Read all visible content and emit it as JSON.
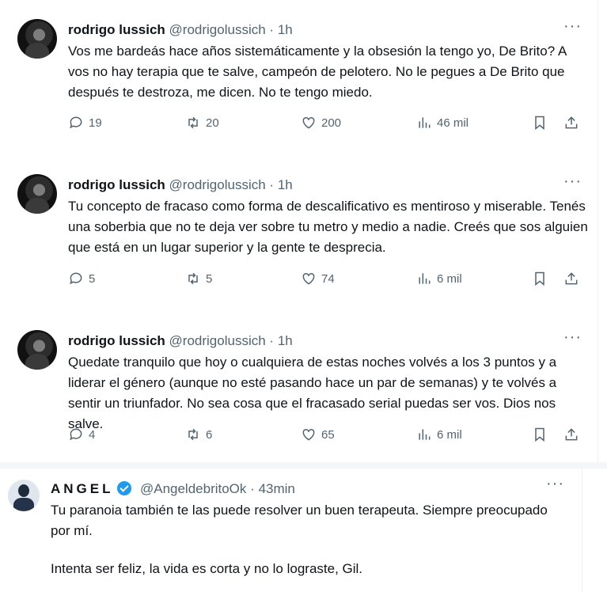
{
  "tweets": [
    {
      "name": "rodrigo lussich",
      "handle": "@rodrigolussich",
      "dot": "·",
      "time": "1h",
      "more": "···",
      "text": "Vos me bardeás hace años sistemáticamente y la obsesión la tengo yo, De Brito? A vos no hay terapia que te salve, campeón de pelotero. No le pegues a De Brito que después te destroza, me dicen. No te tengo miedo.",
      "replies": "19",
      "retweets": "20",
      "likes": "200",
      "views": "46 mil"
    },
    {
      "name": "rodrigo lussich",
      "handle": "@rodrigolussich",
      "dot": "·",
      "time": "1h",
      "more": "···",
      "text": "Tu concepto de fracaso como forma de descalificativo es mentiroso y miserable. Tenés una soberbia que no te deja ver sobre tu metro y medio a nadie. Creés que sos alguien que está en un lugar superior y la gente te desprecia.",
      "replies": "5",
      "retweets": "5",
      "likes": "74",
      "views": "6 mil"
    },
    {
      "name": "rodrigo lussich",
      "handle": "@rodrigolussich",
      "dot": "·",
      "time": "1h",
      "more": "···",
      "text": "Quedate tranquilo que hoy o cualquiera de estas noches volvés a los 3 puntos y a liderar el género (aunque no esté pasando hace un par de semanas) y te volvés a sentir un triunfador. No sea cosa que el fracasado serial puedas ser vos. Dios nos salve.",
      "replies": "4",
      "retweets": "6",
      "likes": "65",
      "views": "6 mil"
    }
  ],
  "reply": {
    "name": "ANGEL",
    "handle": "@AngeldebritoOk",
    "dot": "·",
    "time": "43min",
    "more": "···",
    "text1": "Tu paranoia también te las puede resolver un buen terapeuta. Siempre preocupado por mí.",
    "text2": "Intenta ser feliz, la vida es corta y no lo lograste, Gil."
  },
  "colors": {
    "accent": "#1d9bf0",
    "muted": "#536471",
    "text": "#0f1419"
  },
  "icons": [
    "reply-icon",
    "retweet-icon",
    "like-icon",
    "views-icon",
    "bookmark-icon",
    "share-icon",
    "verified-badge-icon"
  ]
}
